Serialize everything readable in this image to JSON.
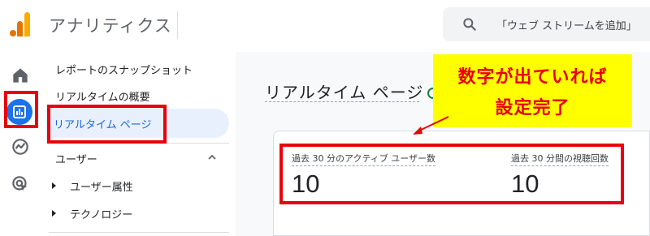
{
  "header": {
    "app_title": "アナリティクス",
    "search_placeholder": "「ウェブ ストリームを追加」"
  },
  "rail": {
    "icons": [
      "home-icon",
      "reports-icon",
      "explore-icon",
      "advertising-icon"
    ],
    "active": "reports-icon"
  },
  "nav": {
    "snapshot": "レポートのスナップショット",
    "overview": "リアルタイムの概要",
    "active_item": "リアルタイム ページ",
    "section": "ユーザー",
    "sub_items": [
      "ユーザー属性",
      "テクノロジー"
    ]
  },
  "main": {
    "page_title": "リアルタイム ページ",
    "metrics": [
      {
        "label": "過去 30 分のアクティブ ユーザー数",
        "value": "10"
      },
      {
        "label": "過去 30 分間の視聴回数",
        "value": "10"
      }
    ]
  },
  "callout": {
    "line1": "数字が出ていれば",
    "line2": "設定完了"
  },
  "colors": {
    "accent": "#1a73e8",
    "active_bg": "#e8f0fe",
    "highlight": "#e8000b",
    "callout_bg": "#ffff00"
  }
}
